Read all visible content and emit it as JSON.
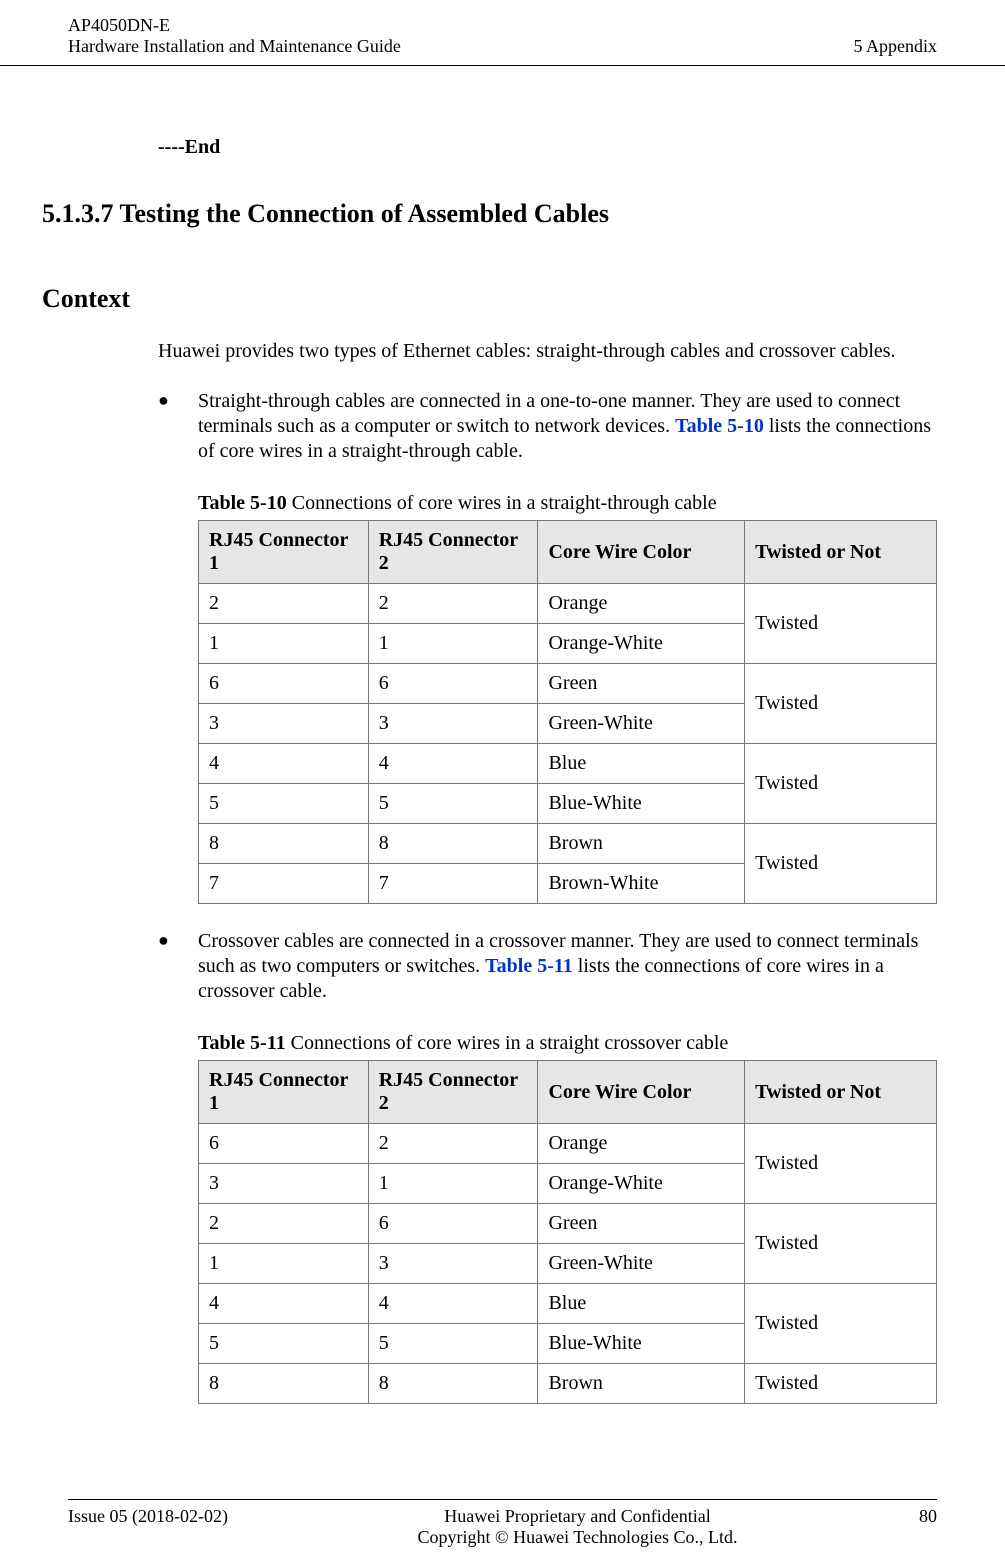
{
  "header": {
    "product": "AP4050DN-E",
    "doc_title": "Hardware Installation and Maintenance Guide",
    "right": "5 Appendix"
  },
  "end_marker": "----End",
  "section_heading": "5.1.3.7 Testing the Connection of Assembled Cables",
  "context_heading": "Context",
  "intro_para": "Huawei provides two types of Ethernet cables: straight-through cables and crossover cables.",
  "bullet1": {
    "pre": "Straight-through cables are connected in a one-to-one manner. They are used to connect terminals such as a computer or switch to network devices. ",
    "xref": "Table 5-10",
    "post": " lists the connections of core wires in a straight-through cable."
  },
  "table1": {
    "caption_num": "Table 5-10",
    "caption_text": " Connections of core wires in a straight-through cable",
    "headers": [
      "RJ45 Connector 1",
      "RJ45 Connector 2",
      "Core Wire Color",
      "Twisted or Not"
    ],
    "rows": [
      {
        "c1": "2",
        "c2": "2",
        "color": "Orange",
        "twist": "Twisted"
      },
      {
        "c1": "1",
        "c2": "1",
        "color": "Orange-White"
      },
      {
        "c1": "6",
        "c2": "6",
        "color": "Green",
        "twist": "Twisted"
      },
      {
        "c1": "3",
        "c2": "3",
        "color": "Green-White"
      },
      {
        "c1": "4",
        "c2": "4",
        "color": "Blue",
        "twist": "Twisted"
      },
      {
        "c1": "5",
        "c2": "5",
        "color": "Blue-White"
      },
      {
        "c1": "8",
        "c2": "8",
        "color": "Brown",
        "twist": "Twisted"
      },
      {
        "c1": "7",
        "c2": "7",
        "color": "Brown-White"
      }
    ]
  },
  "bullet2": {
    "pre": "Crossover cables are connected in a crossover manner. They are used to connect terminals such as two computers or switches. ",
    "xref": "Table 5-11",
    "post": " lists the connections of core wires in a crossover cable."
  },
  "table2": {
    "caption_num": "Table 5-11",
    "caption_text": " Connections of core wires in a straight crossover cable",
    "headers": [
      "RJ45 Connector 1",
      "RJ45 Connector 2",
      "Core Wire Color",
      "Twisted or Not"
    ],
    "rows": [
      {
        "c1": "6",
        "c2": "2",
        "color": "Orange",
        "twist": "Twisted"
      },
      {
        "c1": "3",
        "c2": "1",
        "color": "Orange-White"
      },
      {
        "c1": "2",
        "c2": "6",
        "color": "Green",
        "twist": "Twisted"
      },
      {
        "c1": "1",
        "c2": "3",
        "color": "Green-White"
      },
      {
        "c1": "4",
        "c2": "4",
        "color": "Blue",
        "twist": "Twisted"
      },
      {
        "c1": "5",
        "c2": "5",
        "color": "Blue-White"
      },
      {
        "c1": "8",
        "c2": "8",
        "color": "Brown",
        "twist": "Twisted"
      }
    ]
  },
  "footer": {
    "issue": "Issue 05 (2018-02-02)",
    "line1": "Huawei Proprietary and Confidential",
    "line2": "Copyright © Huawei Technologies Co., Ltd.",
    "page": "80"
  }
}
